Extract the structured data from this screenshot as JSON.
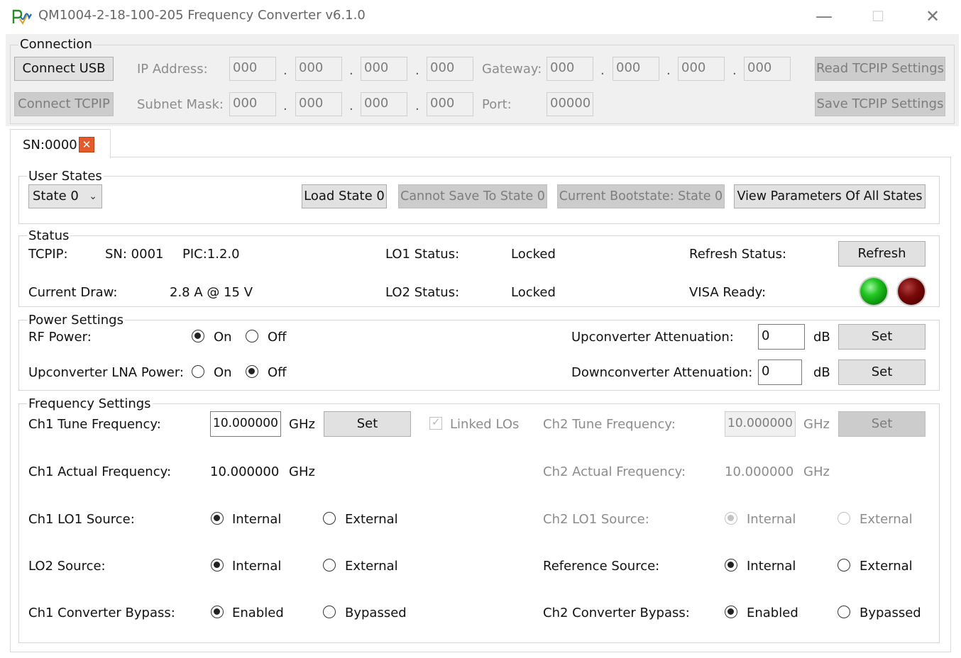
{
  "window": {
    "title": "QM1004-2-18-100-205 Frequency Converter v6.1.0",
    "minimize": "—",
    "maximize": "☐",
    "close": "✕"
  },
  "connection": {
    "legend": "Connection",
    "connect_usb": "Connect USB",
    "connect_tcpip": "Connect TCPIP",
    "ip_label": "IP Address:",
    "ip": [
      "000",
      "000",
      "000",
      "000"
    ],
    "gateway_label": "Gateway:",
    "gateway": [
      "000",
      "000",
      "000",
      "000"
    ],
    "subnet_label": "Subnet Mask:",
    "subnet": [
      "000",
      "000",
      "000",
      "000"
    ],
    "port_label": "Port:",
    "port": "00000",
    "read_tcpip": "Read TCPIP Settings",
    "save_tcpip": "Save TCPIP Settings",
    "dot": "."
  },
  "tab": {
    "label": "SN:0000",
    "close": "✕"
  },
  "user_states": {
    "legend": "User States",
    "selected": "State 0",
    "load": "Load State 0",
    "cannot_save": "Cannot Save To State 0",
    "bootstate": "Current Bootstate: State 0",
    "view_all": "View Parameters Of All States"
  },
  "status": {
    "legend": "Status",
    "tcpip_label": "TCPIP:",
    "sn": "SN: 0001",
    "pic": "PIC:1.2.0",
    "lo1_label": "LO1 Status:",
    "lo1_value": "Locked",
    "refresh_label": "Refresh Status:",
    "refresh_button": "Refresh",
    "draw_label": "Current Draw:",
    "draw_value": "2.8  A @ 15 V",
    "lo2_label": "LO2 Status:",
    "lo2_value": "Locked",
    "visa_label": "VISA Ready:",
    "led_green": "#1fc41f",
    "led_red": "#6e0000"
  },
  "power": {
    "legend": "Power Settings",
    "rf_label": "RF Power:",
    "rf_on": "On",
    "rf_off": "Off",
    "rf_selected": "On",
    "lna_label": "Upconverter LNA Power:",
    "lna_on": "On",
    "lna_off": "Off",
    "lna_selected": "Off",
    "up_att_label": "Upconverter Attenuation:",
    "up_att_value": "0",
    "down_att_label": "Downconverter Attenuation:",
    "down_att_value": "0",
    "db": "dB",
    "set": "Set"
  },
  "frequency": {
    "legend": "Frequency Settings",
    "ch1_tune_label": "Ch1 Tune Frequency:",
    "ch1_tune_value": "10.000000",
    "ghz": "GHz",
    "set": "Set",
    "linked_los": "Linked LOs",
    "ch2_tune_label": "Ch2 Tune Frequency:",
    "ch2_tune_value": "10.000000",
    "ch1_actual_label": "Ch1 Actual Frequency:",
    "ch1_actual_value": "10.000000",
    "ch2_actual_label": "Ch2 Actual Frequency:",
    "ch2_actual_value": "10.000000",
    "ch1_lo1_label": "Ch1 LO1 Source:",
    "ch2_lo1_label": "Ch2 LO1 Source:",
    "lo2_label": "LO2 Source:",
    "ref_label": "Reference Source:",
    "internal": "Internal",
    "external": "External",
    "ch1_bypass_label": "Ch1 Converter Bypass:",
    "ch2_bypass_label": "Ch2 Converter Bypass:",
    "enabled": "Enabled",
    "bypassed": "Bypassed"
  }
}
